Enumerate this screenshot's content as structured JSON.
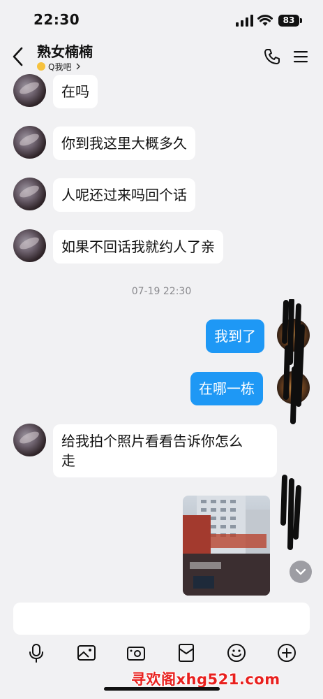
{
  "status_bar": {
    "time": "22:30",
    "battery": "83",
    "icons": [
      "signal-icon",
      "wifi-icon",
      "battery-icon"
    ]
  },
  "header": {
    "title": "熟女楠楠",
    "subtitle": "Q我吧",
    "icons": [
      "back-icon",
      "phone-icon",
      "menu-icon"
    ]
  },
  "messages": [
    {
      "side": "left",
      "text": "在吗"
    },
    {
      "side": "left",
      "text": "你到我这里大概多久"
    },
    {
      "side": "left",
      "text": "人呢还过来吗回个话"
    },
    {
      "side": "left",
      "text": "如果不回话我就约人了亲"
    },
    {
      "side": "right",
      "text": "我到了"
    },
    {
      "side": "right",
      "text": "在哪一栋"
    },
    {
      "side": "left",
      "text_line1": "给我拍个照片看看告诉你怎么",
      "text_line2": "走"
    }
  ],
  "timestamp": "07-19 22:30",
  "input": {
    "value": "",
    "placeholder": ""
  },
  "toolbar": [
    "mic-icon",
    "image-icon",
    "camera-icon",
    "red-packet-icon",
    "emoji-icon",
    "plus-icon"
  ],
  "watermark": "寻欢阁xhg521.com",
  "colors": {
    "background": "#f1f1f3",
    "bubble_mine": "#1e98f5",
    "bubble_other": "#ffffff",
    "watermark": "#e8201e"
  }
}
